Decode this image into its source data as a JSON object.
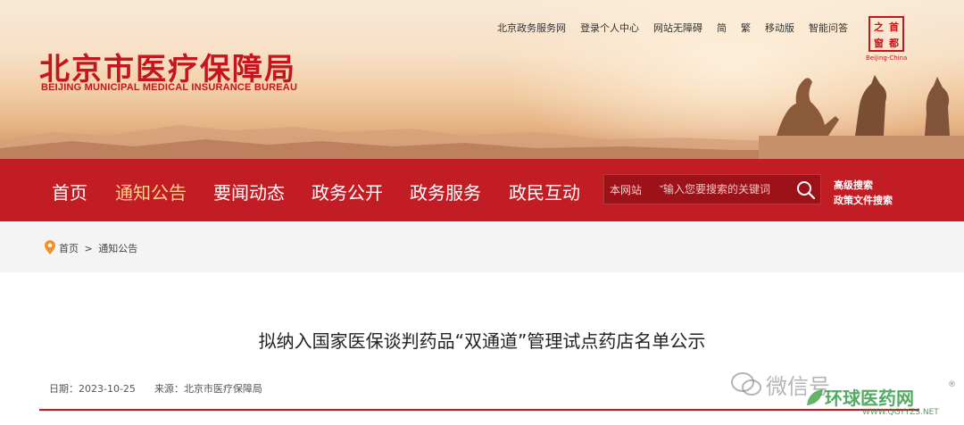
{
  "header": {
    "site_title": "北京市医疗保障局",
    "site_subtitle": "BEIJING MUNICIPAL MEDICAL INSURANCE BUREAU",
    "top_links": [
      "北京政务服务网",
      "登录个人中心",
      "网站无障碍",
      "简",
      "繁",
      "移动版",
      "智能问答"
    ],
    "seal": {
      "chars": [
        "首",
        "都",
        "之",
        "窗"
      ],
      "caption": "Beijing-China"
    }
  },
  "nav": {
    "items": [
      {
        "label": "首页",
        "active": false
      },
      {
        "label": "通知公告",
        "active": true
      },
      {
        "label": "要闻动态",
        "active": false
      },
      {
        "label": "政务公开",
        "active": false
      },
      {
        "label": "政务服务",
        "active": false
      },
      {
        "label": "政民互动",
        "active": false
      }
    ],
    "search": {
      "scope": "本网站",
      "placeholder": "输入您要搜索的关键词",
      "icon": "search-icon"
    },
    "advanced_links": [
      "高级搜索",
      "政策文件搜索"
    ]
  },
  "breadcrumb": {
    "icon": "location-pin-icon",
    "home": "首页",
    "separator": ">",
    "current": "通知公告"
  },
  "article": {
    "title": "拟纳入国家医保谈判药品“双通道”管理试点药店名单公示",
    "date_label": "日期：",
    "date": "2023-10-25",
    "source_label": "来源：",
    "source": "北京市医疗保障局"
  },
  "watermark": {
    "text": "微信号",
    "brand": "环球医药网",
    "url": "WWW.QGYYZS.NET",
    "reg": "®"
  },
  "colors": {
    "brand_red": "#c21c24",
    "active_nav": "#ffd28a",
    "crumb_bg": "#f4f4f4"
  }
}
